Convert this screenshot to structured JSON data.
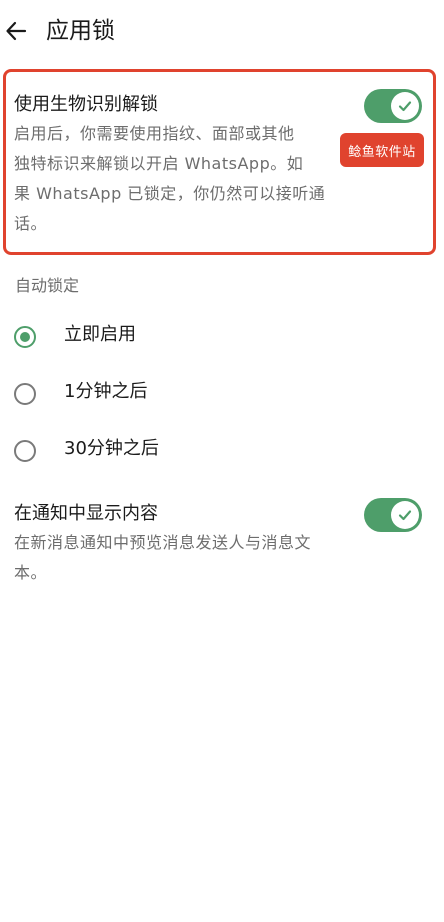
{
  "header": {
    "title": "应用锁",
    "back_icon": "arrow-left-icon"
  },
  "biometric": {
    "title": "使用生物识别解锁",
    "desc_lines": [
      "启用后，你需要使用指纹、面部或其他",
      "独特标识来解锁以开启 WhatsApp。如",
      "果 WhatsApp 已锁定，你仍然可以接听通",
      "话。"
    ],
    "toggle_on": true
  },
  "watermark": "鲶鱼软件站",
  "auto_lock": {
    "label": "自动锁定",
    "options": [
      {
        "label": "立即启用",
        "selected": true
      },
      {
        "label": "1分钟之后",
        "selected": false
      },
      {
        "label": "30分钟之后",
        "selected": false
      }
    ]
  },
  "notification": {
    "title": "在通知中显示内容",
    "desc_lines": [
      "在新消息通知中预览消息发送人与消息文",
      "本。"
    ],
    "toggle_on": true
  },
  "colors": {
    "accent": "#4e9e6a",
    "highlight": "#e0432e"
  }
}
